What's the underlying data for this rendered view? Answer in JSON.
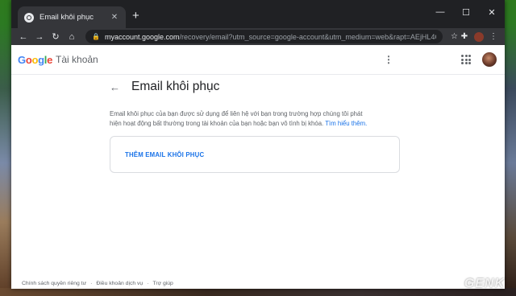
{
  "browser": {
    "tab_title": "Email khôi phục",
    "url_host": "myaccount.google.com",
    "url_path": "/recovery/email?utm_source=google-account&utm_medium=web&rapt=AEjHL4OqX69fR4PccseozWxK4N1..."
  },
  "header": {
    "logo_parts": [
      "G",
      "o",
      "o",
      "g",
      "l",
      "e"
    ],
    "product_name": "Tài khoản"
  },
  "main": {
    "title": "Email khôi phục",
    "description": "Email khôi phục của bạn được sử dụng để liên hệ với bạn trong trường hợp chúng tôi phát hiện hoạt động bất thường trong tài khoản của bạn hoặc bạn vô tình bị khóa.",
    "learn_more": "Tìm hiểu thêm.",
    "add_button": "THÊM EMAIL KHÔI PHỤC"
  },
  "footer": {
    "privacy": "Chính sách quyền riêng tư",
    "terms": "Điều khoản dịch vụ",
    "help": "Trợ giúp"
  },
  "watermark": "GENK",
  "colors": {
    "accent_blue": "#1a73e8",
    "chrome_dark": "#202124",
    "chrome_toolbar": "#35363a"
  }
}
